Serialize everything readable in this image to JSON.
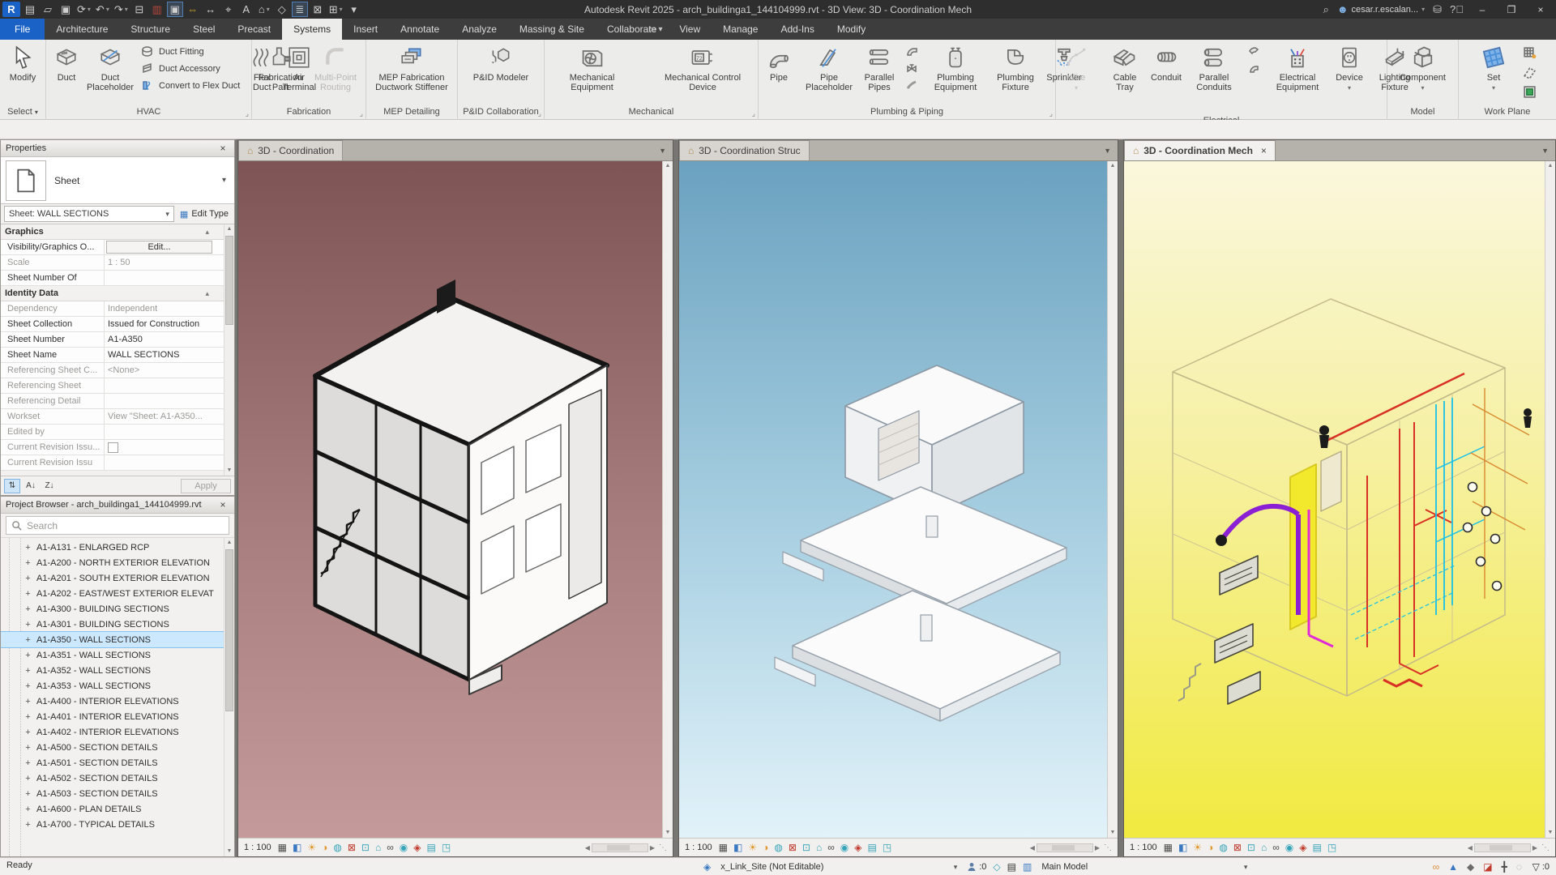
{
  "titlebar": {
    "title": "Autodesk Revit 2025 - arch_buildinga1_144104999.rvt - 3D View: 3D - Coordination Mech",
    "user": "cesar.r.escalan...",
    "qat": [
      {
        "name": "revit-logo",
        "glyph": "R",
        "cls": "logo"
      },
      {
        "name": "file-tabs-icon",
        "glyph": "▤"
      },
      {
        "name": "open-icon",
        "glyph": "▱"
      },
      {
        "name": "save-icon",
        "glyph": "▣"
      },
      {
        "name": "sync-with-central-icon",
        "glyph": "⟳",
        "cls": "drop"
      },
      {
        "name": "undo-icon",
        "glyph": "↶",
        "cls": "drop"
      },
      {
        "name": "redo-icon",
        "glyph": "↷",
        "cls": "drop"
      },
      {
        "name": "print-icon",
        "glyph": "⊟"
      },
      {
        "name": "transfer-standards-icon",
        "glyph": "▥",
        "color": "#b8473a"
      },
      {
        "name": "section-box-icon",
        "glyph": "▣",
        "cls": "boxed"
      },
      {
        "name": "measure-icon",
        "glyph": "⇔",
        "color": "#c9a227"
      },
      {
        "name": "aligned-dimension-icon",
        "glyph": "↔"
      },
      {
        "name": "tag-by-category-icon",
        "glyph": "⌖"
      },
      {
        "name": "text-icon",
        "glyph": "A"
      },
      {
        "name": "default-3d-view-icon",
        "glyph": "⌂",
        "cls": "drop"
      },
      {
        "name": "section-icon",
        "glyph": "◇"
      },
      {
        "name": "thin-lines-icon",
        "glyph": "≣",
        "cls": "boxed"
      },
      {
        "name": "close-inactive-views-icon",
        "glyph": "⊠"
      },
      {
        "name": "switch-windows-icon",
        "glyph": "⊞",
        "cls": "drop"
      },
      {
        "name": "customize-qat-icon",
        "glyph": "▾"
      }
    ]
  },
  "tabs": {
    "items": [
      {
        "name": "tab-file",
        "label": "File",
        "cls": "file"
      },
      {
        "name": "tab-architecture",
        "label": "Architecture"
      },
      {
        "name": "tab-structure",
        "label": "Structure"
      },
      {
        "name": "tab-steel",
        "label": "Steel"
      },
      {
        "name": "tab-precast",
        "label": "Precast"
      },
      {
        "name": "tab-systems",
        "label": "Systems",
        "cls": "active"
      },
      {
        "name": "tab-insert",
        "label": "Insert"
      },
      {
        "name": "tab-annotate",
        "label": "Annotate"
      },
      {
        "name": "tab-analyze",
        "label": "Analyze"
      },
      {
        "name": "tab-massing-site",
        "label": "Massing & Site"
      },
      {
        "name": "tab-collaborate",
        "label": "Collaborate"
      },
      {
        "name": "tab-view",
        "label": "View"
      },
      {
        "name": "tab-manage",
        "label": "Manage"
      },
      {
        "name": "tab-addins",
        "label": "Add-Ins"
      },
      {
        "name": "tab-modify",
        "label": "Modify"
      }
    ]
  },
  "ribbon": {
    "select": {
      "modify": "Modify",
      "footer": "Select"
    },
    "hvac": {
      "duct": "Duct",
      "duct_placeholder": "Duct Placeholder",
      "duct_fitting": "Duct  Fitting",
      "duct_accessory": "Duct  Accessory",
      "convert": "Convert to  Flex Duct",
      "flex_duct": "Flex Duct",
      "air_terminal": "Air Terminal",
      "footer": "HVAC"
    },
    "fabrication": {
      "part": "Fabrication Part",
      "multipoint": "Multi-Point Routing",
      "footer": "Fabrication"
    },
    "mep": {
      "stiffener": "MEP Fabrication Ductwork Stiffener",
      "footer": "MEP Detailing"
    },
    "pid": {
      "modeler": "P&ID Modeler",
      "footer": "P&ID Collaboration"
    },
    "mechanical": {
      "equipment": "Mechanical Equipment",
      "control": "Mechanical Control Device",
      "footer": "Mechanical"
    },
    "plumbing": {
      "pipe": "Pipe",
      "pipe_placeholder": "Pipe Placeholder",
      "parallel_pipes": "Parallel Pipes",
      "equipment": "Plumbing Equipment",
      "fixture": "Plumbing Fixture",
      "sprinkler": "Sprinkler",
      "footer": "Plumbing & Piping"
    },
    "electrical": {
      "wire": "Wire",
      "cable_tray": "Cable Tray",
      "conduit": "Conduit",
      "parallel_conduits": "Parallel Conduits",
      "equipment": "Electrical Equipment",
      "device": "Device",
      "lighting": "Lighting Fixture",
      "footer": "Electrical"
    },
    "model": {
      "component": "Component",
      "footer": "Model"
    },
    "workplane": {
      "set": "Set",
      "footer": "Work Plane"
    }
  },
  "properties": {
    "header": "Properties",
    "type_label": "Sheet",
    "type_selector": "Sheet: WALL SECTIONS",
    "edit_type": "Edit Type",
    "section_graphics": "Graphics",
    "section_identity": "Identity Data",
    "rows_graphics": [
      {
        "label": "Visibility/Graphics O...",
        "value": "Edit...",
        "cls": "btn",
        "name": "property-row-visibility-graphics"
      },
      {
        "label": "Scale",
        "value": "1 : 50",
        "cls": "gray",
        "name": "property-row-scale"
      },
      {
        "label": "Sheet Number Of",
        "value": "",
        "name": "property-row-sheet-number-of"
      }
    ],
    "rows_identity": [
      {
        "label": "Dependency",
        "value": "Independent",
        "cls": "gray",
        "name": "property-row-dependency"
      },
      {
        "label": "Sheet Collection",
        "value": "Issued for Construction",
        "name": "property-row-sheet-collection"
      },
      {
        "label": "Sheet Number",
        "value": "A1-A350",
        "name": "property-row-sheet-number"
      },
      {
        "label": "Sheet Name",
        "value": "WALL SECTIONS",
        "name": "property-row-sheet-name"
      },
      {
        "label": "Referencing Sheet C...",
        "value": "<None>",
        "cls": "gray",
        "name": "property-row-referencing-sheet-c"
      },
      {
        "label": "Referencing Sheet",
        "value": "",
        "cls": "gray",
        "name": "property-row-referencing-sheet"
      },
      {
        "label": "Referencing Detail",
        "value": "",
        "cls": "gray",
        "name": "property-row-referencing-detail"
      },
      {
        "label": "Workset",
        "value": "View \"Sheet: A1-A350...",
        "cls": "gray",
        "name": "property-row-workset"
      },
      {
        "label": "Edited by",
        "value": "",
        "cls": "gray",
        "name": "property-row-edited-by"
      },
      {
        "label": "Current Revision Issu...",
        "value": "",
        "cls": "gray check",
        "name": "property-row-current-revision-issued"
      },
      {
        "label": "Current Revision Issu",
        "value": "",
        "cls": "gray",
        "name": "property-row-current-revision-issued-by"
      }
    ],
    "apply": "Apply"
  },
  "browser": {
    "header": "Project Browser - arch_buildinga1_144104999.rvt",
    "search_placeholder": "Search",
    "items": [
      {
        "label": "A1-A131 - ENLARGED RCP"
      },
      {
        "label": "A1-A200 - NORTH EXTERIOR ELEVATION"
      },
      {
        "label": "A1-A201 - SOUTH EXTERIOR ELEVATION"
      },
      {
        "label": "A1-A202 - EAST/WEST EXTERIOR ELEVAT"
      },
      {
        "label": "A1-A300 - BUILDING SECTIONS"
      },
      {
        "label": "A1-A301 - BUILDING SECTIONS"
      },
      {
        "label": "A1-A350 - WALL SECTIONS",
        "cls": "selected"
      },
      {
        "label": "A1-A351 - WALL SECTIONS"
      },
      {
        "label": "A1-A352 - WALL SECTIONS"
      },
      {
        "label": "A1-A353 - WALL SECTIONS"
      },
      {
        "label": "A1-A400 - INTERIOR ELEVATIONS"
      },
      {
        "label": "A1-A401 - INTERIOR ELEVATIONS"
      },
      {
        "label": "A1-A402 - INTERIOR ELEVATIONS"
      },
      {
        "label": "A1-A500 - SECTION DETAILS"
      },
      {
        "label": "A1-A501 - SECTION DETAILS"
      },
      {
        "label": "A1-A502 - SECTION DETAILS"
      },
      {
        "label": "A1-A503 - SECTION DETAILS"
      },
      {
        "label": "A1-A600 - PLAN DETAILS"
      },
      {
        "label": "A1-A700 - TYPICAL DETAILS"
      }
    ]
  },
  "viewports": {
    "v1": {
      "tab": "3D - Coordination",
      "scale": "1 : 100"
    },
    "v2": {
      "tab": "3D - Coordination Struc",
      "scale": "1 : 100"
    },
    "v3": {
      "tab": "3D - Coordination Mech",
      "scale": "1 : 100"
    }
  },
  "viewbar_icons": [
    {
      "name": "detail-level-icon",
      "glyph": "▦",
      "color": "#4b4b4b"
    },
    {
      "name": "visual-style-icon",
      "glyph": "◧",
      "color": "#3a79c2"
    },
    {
      "name": "sun-settings-icon",
      "glyph": "☀",
      "color": "#e0992f"
    },
    {
      "name": "shadows-icon",
      "glyph": "◑",
      "color": "#e0992f"
    },
    {
      "name": "rendering-dialog-icon",
      "glyph": "◍",
      "color": "#35a3b8"
    },
    {
      "name": "crop-view-icon",
      "glyph": "⊠",
      "color": "#c0392b"
    },
    {
      "name": "crop-region-icon",
      "glyph": "⊡",
      "color": "#35a3b8"
    },
    {
      "name": "unlock-3d-view-icon",
      "glyph": "⌂",
      "color": "#35a3b8"
    },
    {
      "name": "temporary-hide-isolate-icon",
      "glyph": "∞",
      "color": "#4b4b4b"
    },
    {
      "name": "reveal-hidden-elements-icon",
      "glyph": "◉",
      "color": "#35a3b8"
    },
    {
      "name": "worksharing-display-icon",
      "glyph": "◈",
      "color": "#c0392b"
    },
    {
      "name": "temporary-view-properties-icon",
      "glyph": "▤",
      "color": "#35a3b8"
    },
    {
      "name": "displacement-icon",
      "glyph": "◳",
      "color": "#35a3b8"
    }
  ],
  "statusbar": {
    "ready": "Ready",
    "workset_field": "x_Link_Site (Not Editable)",
    "editable_count": ":0",
    "design_option_field": "Main Model",
    "filter_count": ":0",
    "right_icons": [
      {
        "name": "select-links-icon",
        "glyph": "∞",
        "color": "#d98a3a"
      },
      {
        "name": "select-underlay-elements-icon",
        "glyph": "▲",
        "color": "#3a79c2"
      },
      {
        "name": "select-pinned-elements-icon",
        "glyph": "◆",
        "color": "#6b6b6b"
      },
      {
        "name": "select-elements-by-face-icon",
        "glyph": "◪",
        "color": "#c0392b"
      },
      {
        "name": "drag-elements-on-selection-icon",
        "glyph": "╋",
        "color": "#4b4b4b"
      },
      {
        "name": "selection-set-icon",
        "glyph": "◌",
        "color": "#9a9a9a"
      }
    ]
  }
}
